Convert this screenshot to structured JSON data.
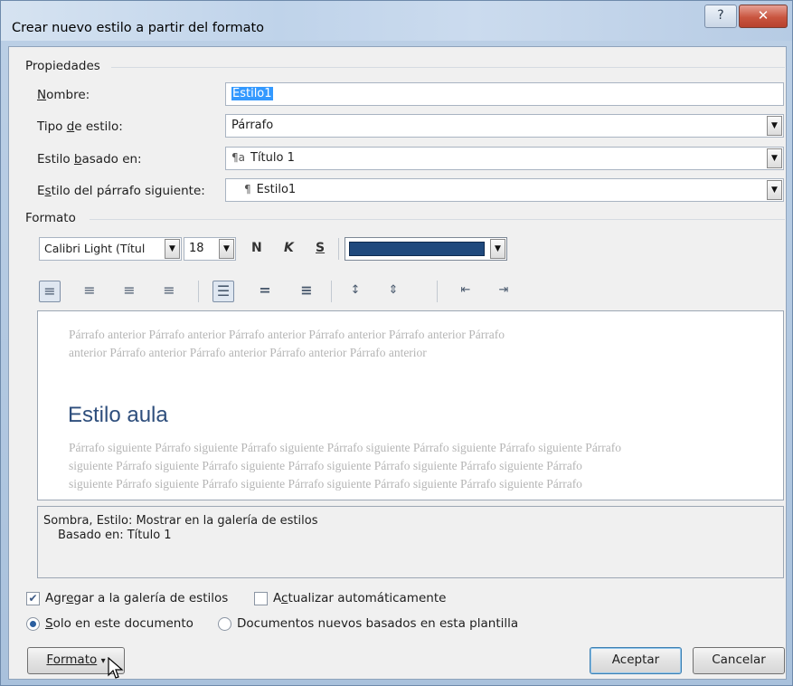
{
  "window": {
    "title": "Crear nuevo estilo a partir del formato",
    "help_icon": "question-mark",
    "close_icon": "x"
  },
  "properties": {
    "group_title": "Propiedades",
    "name_label_u": "N",
    "name_label_rest": "ombre:",
    "name_value": "Estilo1",
    "type_label_pre": "Tipo ",
    "type_label_u": "d",
    "type_label_rest": "e estilo:",
    "type_value": "Párrafo",
    "based_label_pre": "Estilo ",
    "based_label_u": "b",
    "based_label_rest": "asado en:",
    "based_value": "Título 1",
    "based_icon": "linked-style-icon",
    "next_label_pre": "E",
    "next_label_u": "s",
    "next_label_rest": "tilo del párrafo siguiente:",
    "next_value": "Estilo1",
    "next_icon": "pilcrow"
  },
  "format": {
    "group_title": "Formato",
    "font_value": "Calibri Light (Títul",
    "size_value": "18",
    "bold_label": "N",
    "italic_label": "K",
    "underline_label": "S",
    "font_color": "#1f497d"
  },
  "preview": {
    "prev_para_line1": "Párrafo anterior Párrafo anterior Párrafo anterior Párrafo anterior Párrafo anterior Párrafo",
    "prev_para_line2": "anterior Párrafo anterior Párrafo anterior Párrafo anterior Párrafo anterior",
    "style_sample": "Estilo aula",
    "next_para_line1": "Párrafo siguiente Párrafo siguiente Párrafo siguiente Párrafo siguiente Párrafo siguiente Párrafo siguiente Párrafo",
    "next_para_line2": "siguiente Párrafo siguiente Párrafo siguiente Párrafo siguiente Párrafo siguiente Párrafo siguiente Párrafo",
    "next_para_line3": "siguiente Párrafo siguiente Párrafo siguiente Párrafo siguiente Párrafo siguiente Párrafo siguiente Párrafo"
  },
  "description": {
    "line1": "Sombra, Estilo: Mostrar en la galería de estilos",
    "line2": "Basado en: Título 1"
  },
  "options": {
    "add_gallery_pre": "Agr",
    "add_gallery_u": "e",
    "add_gallery_rest": "gar a la galería de estilos",
    "add_gallery_checked": true,
    "auto_update_pre": "A",
    "auto_update_u": "c",
    "auto_update_rest": "tualizar automáticamente",
    "auto_update_checked": false,
    "only_doc_u": "S",
    "only_doc_rest": "olo en este documento",
    "only_doc_selected": true,
    "new_docs_label": "Documentos nuevos basados en esta plantilla",
    "new_docs_selected": false
  },
  "buttons": {
    "format_pre": "F",
    "format_u": "o",
    "format_rest": "rmato",
    "format_arrow": "▾",
    "ok": "Aceptar",
    "cancel": "Cancelar"
  }
}
